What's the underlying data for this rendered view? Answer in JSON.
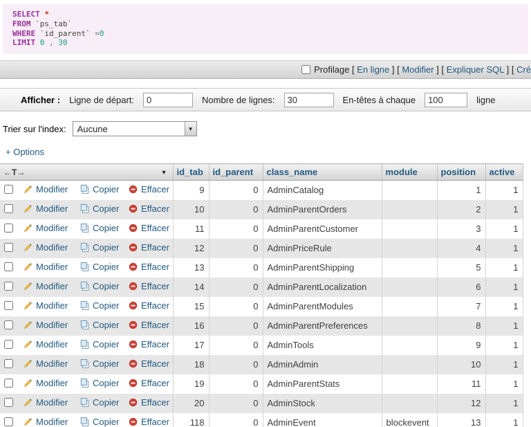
{
  "colors": {
    "link": "#235a81",
    "header_text": "#235a81",
    "sql_background": "#f8eef8",
    "sql_keyword": "#993399",
    "sql_number": "#1a9988",
    "sql_star": "#cc2a00",
    "row_alternate": "#e6e6e6",
    "delete_icon_red": "#d04437",
    "pencil_icon_gold": "#f3c13a"
  },
  "sql": {
    "lines": [
      [
        {
          "text": "SELECT",
          "cls": "kw"
        },
        {
          "text": " ",
          "cls": ""
        },
        {
          "text": "*",
          "cls": "star"
        }
      ],
      [
        {
          "text": "FROM",
          "cls": "kw"
        },
        {
          "text": " ",
          "cls": ""
        },
        {
          "text": "`ps_tab`",
          "cls": "ident"
        }
      ],
      [
        {
          "text": "WHERE",
          "cls": "kw"
        },
        {
          "text": " ",
          "cls": ""
        },
        {
          "text": "`id_parent`",
          "cls": "ident"
        },
        {
          "text": " ",
          "cls": ""
        },
        {
          "text": "=",
          "cls": "op"
        },
        {
          "text": "0",
          "cls": "num"
        }
      ],
      [
        {
          "text": "LIMIT",
          "cls": "kw"
        },
        {
          "text": " ",
          "cls": ""
        },
        {
          "text": "0",
          "cls": "num"
        },
        {
          "text": " , ",
          "cls": "op"
        },
        {
          "text": "30",
          "cls": "num"
        }
      ]
    ]
  },
  "profiling": {
    "parts": [
      {
        "type": "text",
        "value": "Profilage [ "
      },
      {
        "type": "link",
        "value": "En ligne"
      },
      {
        "type": "text",
        "value": " ] [ "
      },
      {
        "type": "link",
        "value": "Modifier"
      },
      {
        "type": "text",
        "value": " ] [ "
      },
      {
        "type": "link",
        "value": "Expliquer SQL"
      },
      {
        "type": "text",
        "value": " ] [ "
      },
      {
        "type": "link",
        "value": "Cré"
      }
    ]
  },
  "display_bar": {
    "show_label": "Afficher :",
    "start_row_label": "Ligne de départ:",
    "start_row_value": "0",
    "num_rows_label": "Nombre de lignes:",
    "num_rows_value": "30",
    "headers_every_label": "En-têtes à chaque",
    "headers_every_value": "100",
    "rows_unit_label": "ligne"
  },
  "sort_bar": {
    "label": "Trier sur l'index:",
    "selected_option": "Aucune"
  },
  "options_toggle_label": "+ Options",
  "icons": {
    "dropdown_arrow": "▼",
    "sort_descending": "▼",
    "header_arrows": "←T→"
  },
  "table": {
    "columns": [
      "id_tab",
      "id_parent",
      "class_name",
      "module",
      "position",
      "active"
    ],
    "row_actions": [
      {
        "name": "edit-link",
        "icon": "pencil-icon",
        "label": "Modifier"
      },
      {
        "name": "copy-link",
        "icon": "copy-icon",
        "label": "Copier"
      },
      {
        "name": "delete-link",
        "icon": "delete-icon",
        "label": "Effacer"
      }
    ],
    "rows": [
      {
        "id_tab": "9",
        "id_parent": "0",
        "class_name": "AdminCatalog",
        "module": "",
        "position": "1",
        "active": "1"
      },
      {
        "id_tab": "10",
        "id_parent": "0",
        "class_name": "AdminParentOrders",
        "module": "",
        "position": "2",
        "active": "1"
      },
      {
        "id_tab": "11",
        "id_parent": "0",
        "class_name": "AdminParentCustomer",
        "module": "",
        "position": "3",
        "active": "1"
      },
      {
        "id_tab": "12",
        "id_parent": "0",
        "class_name": "AdminPriceRule",
        "module": "",
        "position": "4",
        "active": "1"
      },
      {
        "id_tab": "13",
        "id_parent": "0",
        "class_name": "AdminParentShipping",
        "module": "",
        "position": "5",
        "active": "1"
      },
      {
        "id_tab": "14",
        "id_parent": "0",
        "class_name": "AdminParentLocalization",
        "module": "",
        "position": "6",
        "active": "1"
      },
      {
        "id_tab": "15",
        "id_parent": "0",
        "class_name": "AdminParentModules",
        "module": "",
        "position": "7",
        "active": "1"
      },
      {
        "id_tab": "16",
        "id_parent": "0",
        "class_name": "AdminParentPreferences",
        "module": "",
        "position": "8",
        "active": "1"
      },
      {
        "id_tab": "17",
        "id_parent": "0",
        "class_name": "AdminTools",
        "module": "",
        "position": "9",
        "active": "1"
      },
      {
        "id_tab": "18",
        "id_parent": "0",
        "class_name": "AdminAdmin",
        "module": "",
        "position": "10",
        "active": "1"
      },
      {
        "id_tab": "19",
        "id_parent": "0",
        "class_name": "AdminParentStats",
        "module": "",
        "position": "11",
        "active": "1"
      },
      {
        "id_tab": "20",
        "id_parent": "0",
        "class_name": "AdminStock",
        "module": "",
        "position": "12",
        "active": "1"
      },
      {
        "id_tab": "118",
        "id_parent": "0",
        "class_name": "AdminEvent",
        "module": "blockevent",
        "position": "13",
        "active": "1"
      }
    ]
  }
}
